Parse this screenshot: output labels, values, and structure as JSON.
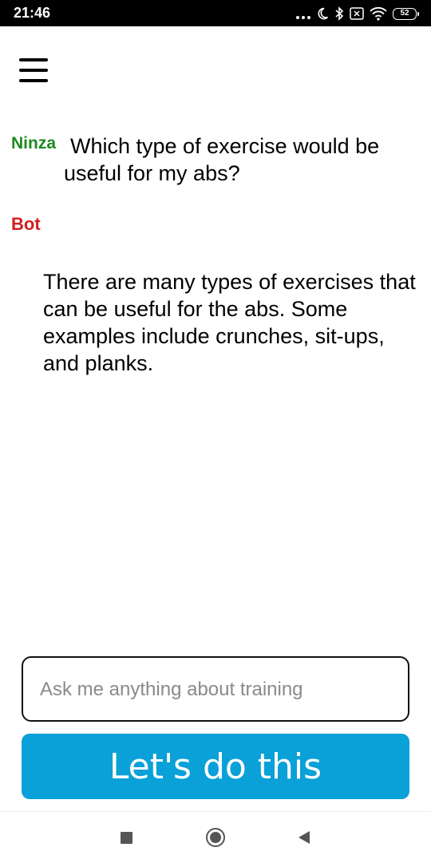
{
  "status_bar": {
    "time": "21:46",
    "battery": "52",
    "icons": [
      "more-dots-icon",
      "moon-icon",
      "bluetooth-icon",
      "no-sim-icon",
      "wifi-icon",
      "battery-icon"
    ]
  },
  "chat": {
    "messages": [
      {
        "sender": "Ninza",
        "text": "Which type of exercise would be useful for my abs?",
        "sender_color": "#1e8a1e"
      },
      {
        "sender": "Bot",
        "text": "There are many types of exercises that can be useful for the abs. Some examples include crunches, sit-ups, and planks.",
        "sender_color": "#d21f1f"
      }
    ]
  },
  "composer": {
    "placeholder": "Ask me anything about training",
    "value": "",
    "submit_label": "Let's do this",
    "submit_color": "#0aa0d8"
  },
  "nav_bar": {
    "buttons": [
      "recents-square-icon",
      "home-circle-icon",
      "back-triangle-icon"
    ]
  }
}
